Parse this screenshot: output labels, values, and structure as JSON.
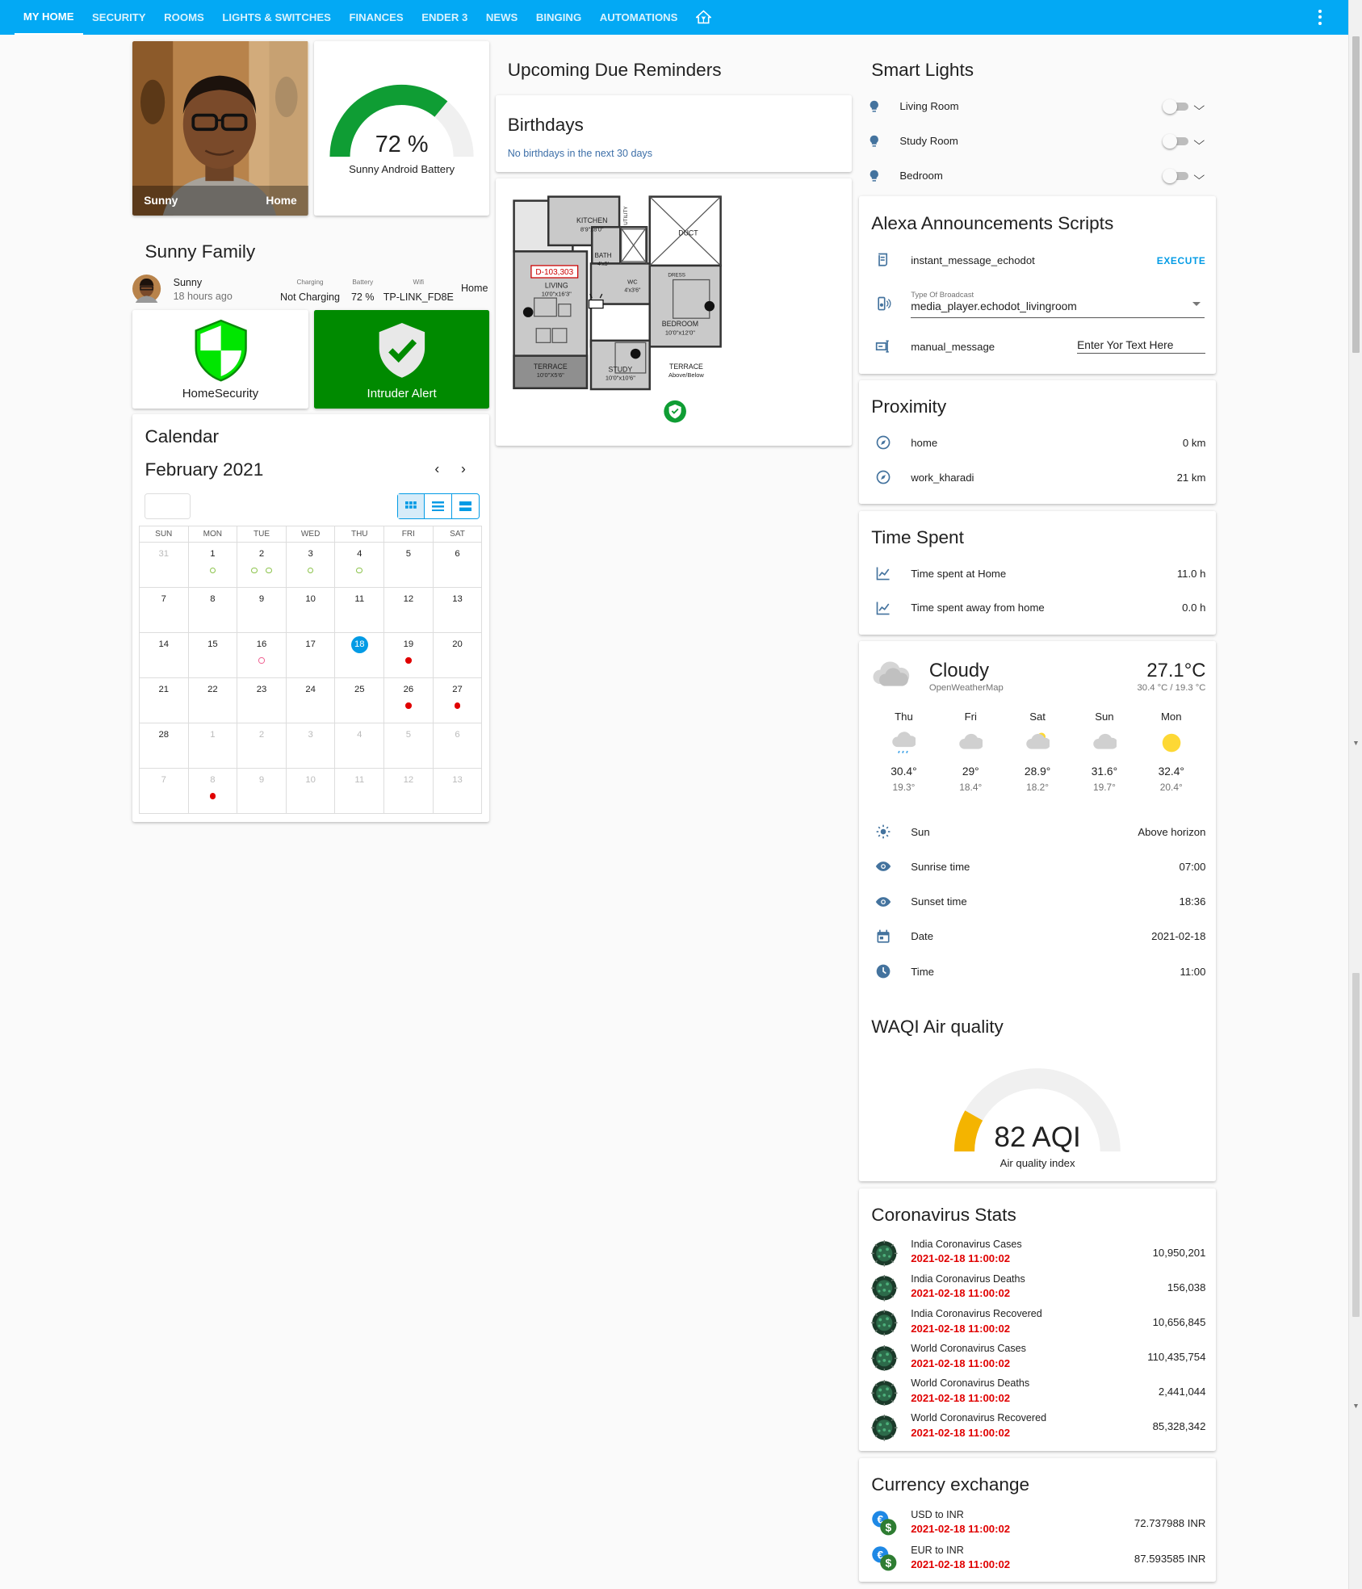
{
  "nav": {
    "tabs": [
      "MY HOME",
      "SECURITY",
      "ROOMS",
      "LIGHTS & SWITCHES",
      "FINANCES",
      "ENDER 3",
      "NEWS",
      "BINGING",
      "AUTOMATIONS"
    ],
    "more_icon": "dots-vertical-icon",
    "home_icon": "home-assistant-icon"
  },
  "colors": {
    "primary": "#03a9f4",
    "green": "#0f9d34",
    "bright_green": "#00e600",
    "intruder_bg": "#008a00",
    "red": "#e00000",
    "blue": "#039be5"
  },
  "person": {
    "name": "Sunny",
    "state": "Home"
  },
  "battery": {
    "value": 72,
    "text": "72 %",
    "label": "Sunny Android Battery"
  },
  "family": {
    "title": "Sunny Family",
    "name": "Sunny",
    "last_seen": "18 hours ago",
    "charging_label": "Charging",
    "charging_value": "Not Charging",
    "battery_label": "Battery",
    "battery_value": "72 %",
    "wifi_label": "Wifi",
    "wifi_value": "TP-LINK_FD8E",
    "location": "Home"
  },
  "security": {
    "home_label": "HomeSecurity",
    "intruder_label": "Intruder Alert"
  },
  "calendar": {
    "title": "Calendar",
    "month": "February 2021",
    "weekdays": [
      "SUN",
      "MON",
      "TUE",
      "WED",
      "THU",
      "FRI",
      "SAT"
    ],
    "days": [
      "31",
      "1",
      "2",
      "3",
      "4",
      "5",
      "6",
      "7",
      "8",
      "9",
      "10",
      "11",
      "12",
      "13",
      "14",
      "15",
      "16",
      "17",
      "18",
      "19",
      "20",
      "21",
      "22",
      "23",
      "24",
      "25",
      "26",
      "27",
      "28",
      "1",
      "2",
      "3",
      "4",
      "5",
      "6",
      "7",
      "8",
      "9",
      "10",
      "11",
      "12",
      "13"
    ],
    "today": "18"
  },
  "reminders": {
    "title": "Upcoming Due Reminders",
    "birthdays_title": "Birthdays",
    "birthdays_text": "No birthdays in the next 30 days"
  },
  "floorplan": {
    "unit": "D-103,303",
    "kitchen": "KITCHEN",
    "kitchen_dim": "8'9\"x8'0\"",
    "duct": "DUCT",
    "bath": "BATH",
    "bath_dim": "4'x5'",
    "wc": "WC",
    "wc_dim": "4'x3'6\"",
    "living": "LIVING",
    "living_dim": "10'0\"x16'3\"",
    "bedroom": "BEDROOM",
    "bedroom_dim": "10'0\"x12'0\"",
    "study": "STUDY",
    "study_dim": "10'0\"x10'6\"",
    "terrace": "TERRACE",
    "terrace_dim": "10'0\"X5'6\"",
    "terrace2": "TERRACE",
    "terrace2_sub": "Above/Below",
    "utility": "UTILITY",
    "dress": "DRESS"
  },
  "smart_lights": {
    "title": "Smart Lights",
    "items": [
      "Living Room",
      "Study Room",
      "Bedroom"
    ]
  },
  "alexa": {
    "title": "Alexa Announcements Scripts",
    "script_name": "instant_message_echodot",
    "execute": "EXECUTE",
    "broadcast_label": "Type Of Broadcast",
    "broadcast_value": "media_player.echodot_livingroom",
    "manual_label": "manual_message",
    "manual_value": "Enter Yor Text Here"
  },
  "proximity": {
    "title": "Proximity",
    "items": [
      {
        "name": "home",
        "value": "0 km"
      },
      {
        "name": "work_kharadi",
        "value": "21 km"
      }
    ]
  },
  "time_spent": {
    "title": "Time Spent",
    "items": [
      {
        "name": "Time spent at Home",
        "value": "11.0 h"
      },
      {
        "name": "Time spent away from home",
        "value": "0.0 h"
      }
    ]
  },
  "weather": {
    "condition": "Cloudy",
    "provider": "OpenWeatherMap",
    "temp": "27.1°C",
    "range": "30.4 °C / 19.3 °C",
    "forecast": [
      {
        "day": "Thu",
        "high": "30.4°",
        "low": "19.3°",
        "icon": "rainy-icon"
      },
      {
        "day": "Fri",
        "high": "29°",
        "low": "18.4°",
        "icon": "cloudy-icon"
      },
      {
        "day": "Sat",
        "high": "28.9°",
        "low": "18.2°",
        "icon": "partly-cloudy-icon"
      },
      {
        "day": "Sun",
        "high": "31.6°",
        "low": "19.7°",
        "icon": "cloudy-icon"
      },
      {
        "day": "Mon",
        "high": "32.4°",
        "low": "20.4°",
        "icon": "sunny-icon"
      }
    ],
    "rows": [
      {
        "name": "Sun",
        "value": "Above horizon",
        "icon": "sun-icon"
      },
      {
        "name": "Sunrise time",
        "value": "07:00",
        "icon": "eye-icon"
      },
      {
        "name": "Sunset time",
        "value": "18:36",
        "icon": "eye-icon"
      },
      {
        "name": "Date",
        "value": "2021-02-18",
        "icon": "calendar-icon"
      },
      {
        "name": "Time",
        "value": "11:00",
        "icon": "clock-icon"
      }
    ]
  },
  "aqi": {
    "title": "WAQI Air quality",
    "value": 82,
    "text": "82 AQI",
    "label": "Air quality index"
  },
  "corona": {
    "title": "Coronavirus Stats",
    "items": [
      {
        "name": "India Coronavirus Cases",
        "time": "2021-02-18 11:00:02",
        "value": "10,950,201"
      },
      {
        "name": "India Coronavirus Deaths",
        "time": "2021-02-18 11:00:02",
        "value": "156,038"
      },
      {
        "name": "India Coronavirus Recovered",
        "time": "2021-02-18 11:00:02",
        "value": "10,656,845"
      },
      {
        "name": "World Coronavirus Cases",
        "time": "2021-02-18 11:00:02",
        "value": "110,435,754"
      },
      {
        "name": "World Coronavirus Deaths",
        "time": "2021-02-18 11:00:02",
        "value": "2,441,044"
      },
      {
        "name": "World Coronavirus Recovered",
        "time": "2021-02-18 11:00:02",
        "value": "85,328,342"
      }
    ]
  },
  "currency": {
    "title": "Currency exchange",
    "items": [
      {
        "name": "USD to INR",
        "time": "2021-02-18 11:00:02",
        "value": "72.737988 INR"
      },
      {
        "name": "EUR to INR",
        "time": "2021-02-18 11:00:02",
        "value": "87.593585 INR"
      }
    ]
  }
}
